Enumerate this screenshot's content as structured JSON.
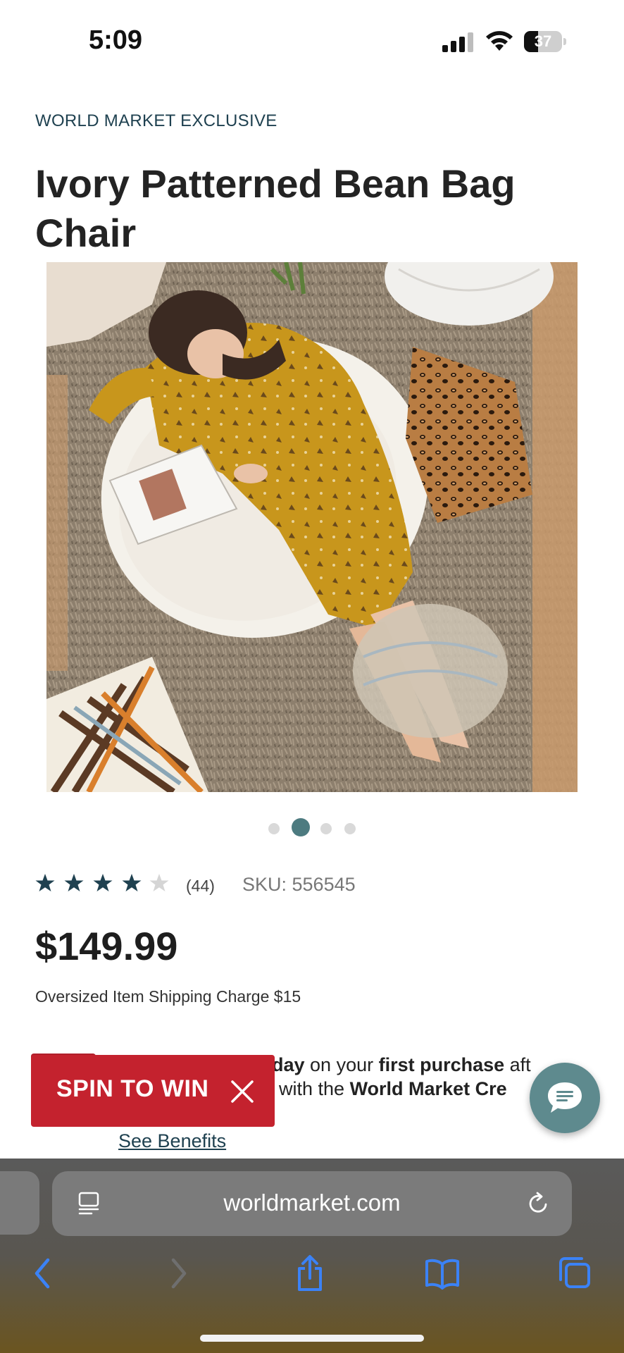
{
  "status_bar": {
    "time": "5:09",
    "battery_level": "37",
    "battery_fraction": 0.37
  },
  "product": {
    "eyebrow": "WORLD MARKET EXCLUSIVE",
    "title": "Ivory Patterned Bean Bag Chair",
    "rating": 4.5,
    "review_count": "(44)",
    "sku": "SKU: 556545",
    "price": "$149.99",
    "shipping_note": "Oversized Item Shipping Charge $15"
  },
  "carousel": {
    "total": 4,
    "active_index": 1
  },
  "promo": {
    "line1_part1": "day",
    "line1_part2": " on your ",
    "line1_part3": "first purchase",
    "line1_part4": " aft",
    "line2_part1": "with the ",
    "line2_part2": "World Market Cre",
    "see_benefits": "See Benefits"
  },
  "spin_to_win": {
    "label": "SPIN TO WIN"
  },
  "browser": {
    "url": "worldmarket.com"
  },
  "colors": {
    "brand_teal": "#4d7b80",
    "navy_text": "#1f4150",
    "spin_red": "#c4222e",
    "ios_blue": "#3b82f6"
  },
  "icons": {
    "signal": "cellular-signal-icon",
    "wifi": "wifi-icon",
    "battery": "battery-icon",
    "star": "star-icon",
    "close": "close-icon",
    "chat": "chat-bubble-icon",
    "reader": "reader-mode-icon",
    "reload": "reload-icon",
    "back": "chevron-left-icon",
    "forward": "chevron-right-icon",
    "share": "share-icon",
    "bookmarks": "book-icon",
    "tabs": "tabs-icon"
  }
}
